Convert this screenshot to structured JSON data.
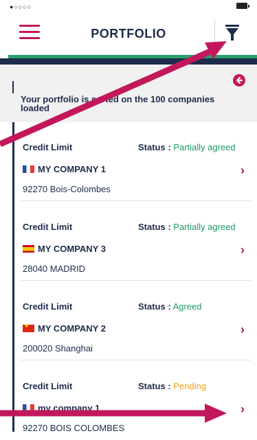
{
  "header": {
    "title": "PORTFOLIO",
    "menu_icon": "menu-icon",
    "filter_icon": "filter-icon"
  },
  "info": {
    "text": "Your portfolio is sorted on the 100 companies loaded"
  },
  "cards": [
    {
      "type": "Credit Limit",
      "status_label": "Status :",
      "status_value": "Partially agreed",
      "status_color": "#1e9a66",
      "flag": "france-flag-icon",
      "company": "MY COMPANY 1",
      "address": "92270 Bois-Colombes"
    },
    {
      "type": "Credit Limit",
      "status_label": "Status :",
      "status_value": "Partially agreed",
      "status_color": "#1e9a66",
      "flag": "spain-flag-icon",
      "company": "MY COMPANY 3",
      "address": "28040 MADRID"
    },
    {
      "type": "Credit Limit",
      "status_label": "Status :",
      "status_value": "Agreed",
      "status_color": "#1e9a66",
      "flag": "china-flag-icon",
      "company": "MY COMPANY 2",
      "address": "200020 Shanghai"
    },
    {
      "type": "Credit Limit",
      "status_label": "Status :",
      "status_value": "Pending",
      "status_color": "#f39c12",
      "flag": "france-flag-icon",
      "company": "my company 1",
      "address": "92270 BOIS COLOMBES"
    }
  ],
  "colors": {
    "accent": "#c2185b",
    "navy": "#1e2b4a",
    "green": "#28a06a"
  }
}
